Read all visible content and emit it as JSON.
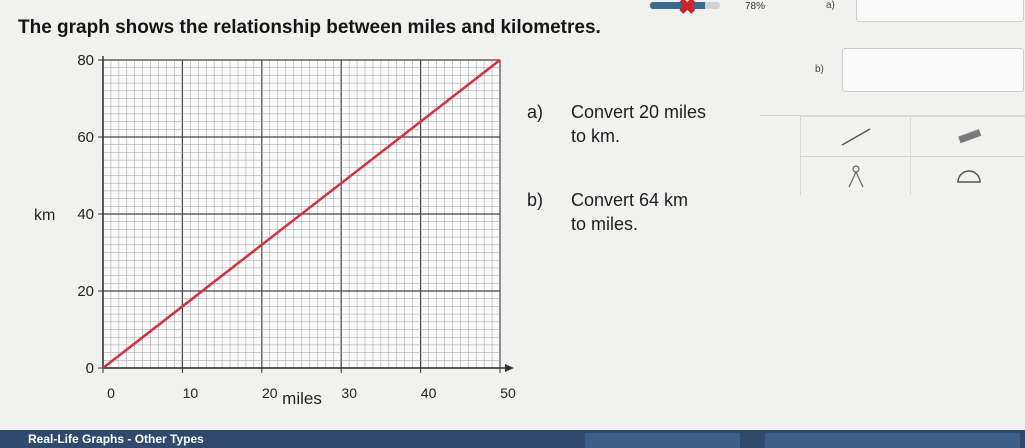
{
  "status": {
    "progress_percent": 78,
    "progress_label": "78%",
    "part_a_tab": "a)",
    "part_b_tab": "b)"
  },
  "question": {
    "title": "The graph shows the relationship between miles and kilometres.",
    "part_a_letter": "a)",
    "part_a_line1": "Convert 20 miles",
    "part_a_line2": "to km.",
    "part_b_letter": "b)",
    "part_b_line1": "Convert 64 km",
    "part_b_line2": "to miles."
  },
  "tools": [
    {
      "name": "ruler",
      "icon": "ruler-icon"
    },
    {
      "name": "pencil",
      "icon": "pencil-icon"
    },
    {
      "name": "compass",
      "icon": "compass-icon"
    },
    {
      "name": "protractor",
      "icon": "protractor-icon"
    }
  ],
  "footer": {
    "title": "Real-Life Graphs - Other Types"
  },
  "colors": {
    "line": "#d8303a",
    "grid": "#6b6b6b",
    "footer": "#2f4a6d"
  },
  "chart_data": {
    "type": "line",
    "title": "",
    "xlabel": "miles",
    "ylabel": "km",
    "xlim": [
      0,
      50
    ],
    "ylim": [
      0,
      80
    ],
    "x_ticks": [
      0,
      10,
      20,
      30,
      40,
      50
    ],
    "y_ticks": [
      0,
      20,
      40,
      60,
      80
    ],
    "x_tick_labels": [
      "0",
      "10",
      "20",
      "30",
      "40",
      "50"
    ],
    "y_tick_labels": [
      "0",
      "20",
      "40",
      "60",
      "80"
    ],
    "grid": true,
    "series": [
      {
        "x": [
          0,
          50
        ],
        "y": [
          0,
          80
        ]
      }
    ]
  }
}
